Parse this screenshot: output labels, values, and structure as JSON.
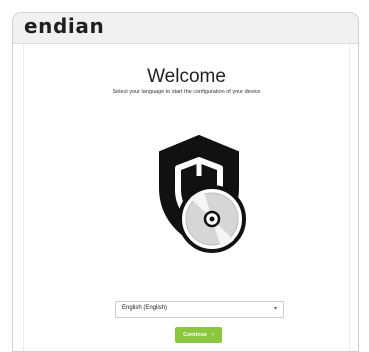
{
  "header": {
    "logo_text": "endian"
  },
  "main": {
    "title": "Welcome",
    "subtitle": "Select your language to start the configuration of your device"
  },
  "language_select": {
    "value": "English (English)",
    "caret": "▾"
  },
  "continue_button": {
    "label": "Continue",
    "arrow": "›"
  },
  "colors": {
    "accent_green": "#8cc63f",
    "shield": "#111111",
    "header_bg": "#f1f1f1"
  },
  "icons": {
    "hero": "shield-with-disc-icon"
  }
}
